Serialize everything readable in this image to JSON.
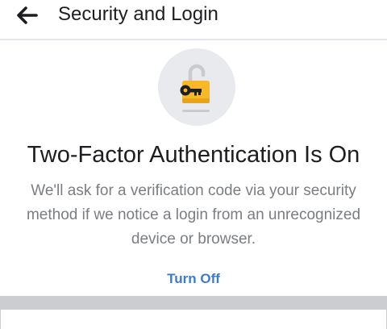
{
  "header": {
    "back_icon": "back-arrow-icon",
    "title": "Security and Login"
  },
  "status": {
    "icon": "unlocked-padlock-with-key-icon",
    "title": "Two-Factor Authentication Is On",
    "description": "We'll ask for a verification code via your security method if we notice a login from an unrecognized device or browser.",
    "turn_off_label": "Turn Off"
  },
  "colors": {
    "link": "#3b7bd4",
    "lock_body": "#f7b928",
    "icon_background": "#e9eaed",
    "divider": "#cbcdd1"
  }
}
